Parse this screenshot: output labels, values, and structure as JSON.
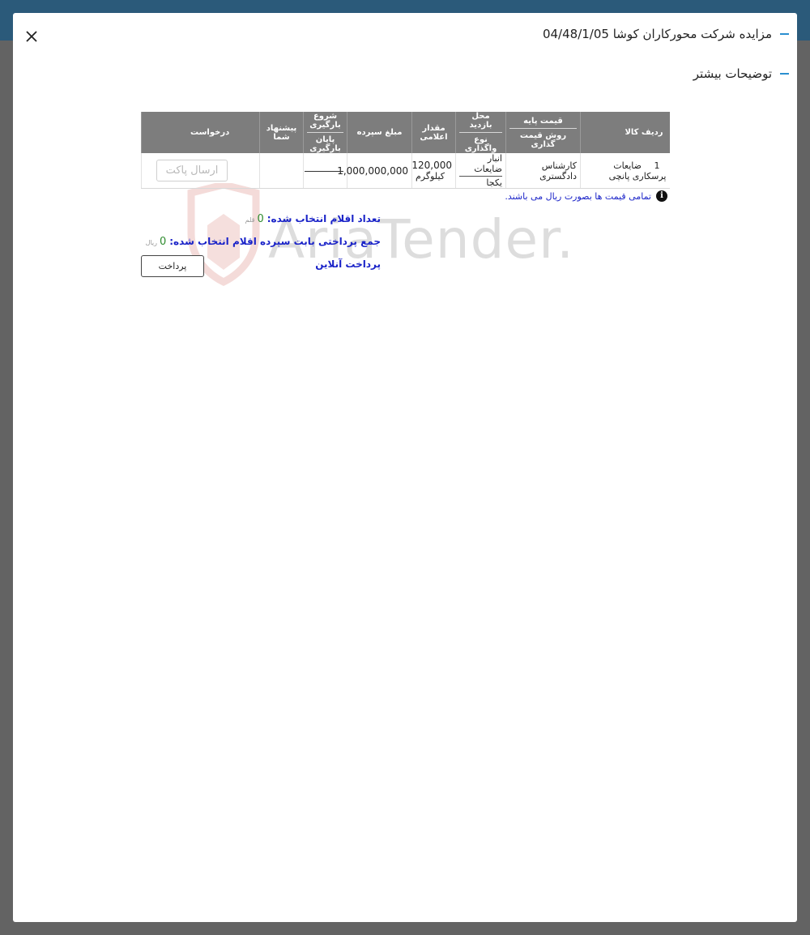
{
  "modal": {
    "title": "مزایده شرکت محورکاران کوشا 04/48/1/05",
    "section_title": "توضیحات بیشتر",
    "close_icon": "close-icon"
  },
  "table": {
    "headers": {
      "row_item": "ردیف کالا",
      "base_price": "قیمت پایه",
      "pricing_method": "روش قیمت گذاری",
      "visit_location": "محل بازدید",
      "transfer_type": "نوع واگذاری",
      "announced_amount": "مقدار اعلامی",
      "deposit_amount": "مبلغ سپرده",
      "loading_start": "شروع بارگیری",
      "loading_end": "پایان بارگیری",
      "your_offer": "پیشنهاد شما",
      "request": "درخواست"
    },
    "rows": [
      {
        "row_no": "1",
        "item": "ضایعات پرسکاری پانچی",
        "pricing": "کارشناس دادگستری",
        "visit_location": "انبار ضایعات",
        "transfer_type": "یکجا",
        "amount": "120,000",
        "unit": "کیلوگرم",
        "deposit": "1,000,000,000",
        "send_button": "ارسال پاکت"
      }
    ]
  },
  "note": "تمامی قیمت ها بصورت ریال می باشند.",
  "summary": {
    "count_label": "تعداد اقلام انتخاب شده:",
    "count_value": "0",
    "count_unit": "قلم",
    "sum_label": "جمع پرداختی بابت سپرده اقلام انتخاب شده:",
    "sum_value": "0",
    "sum_unit": "ریال",
    "online_payment": "پرداخت آنلاین",
    "pay_button": "پرداخت"
  },
  "watermark": "AriaTender.neT",
  "colors": {
    "topbar": "#2b5a7a",
    "backdrop": "#636363",
    "accent_dash": "#2a8fd0",
    "table_header": "#7d7d7d",
    "link_blue": "#1a23c8",
    "value_green": "#2e8b2e",
    "watermark_red": "#c0392b"
  }
}
